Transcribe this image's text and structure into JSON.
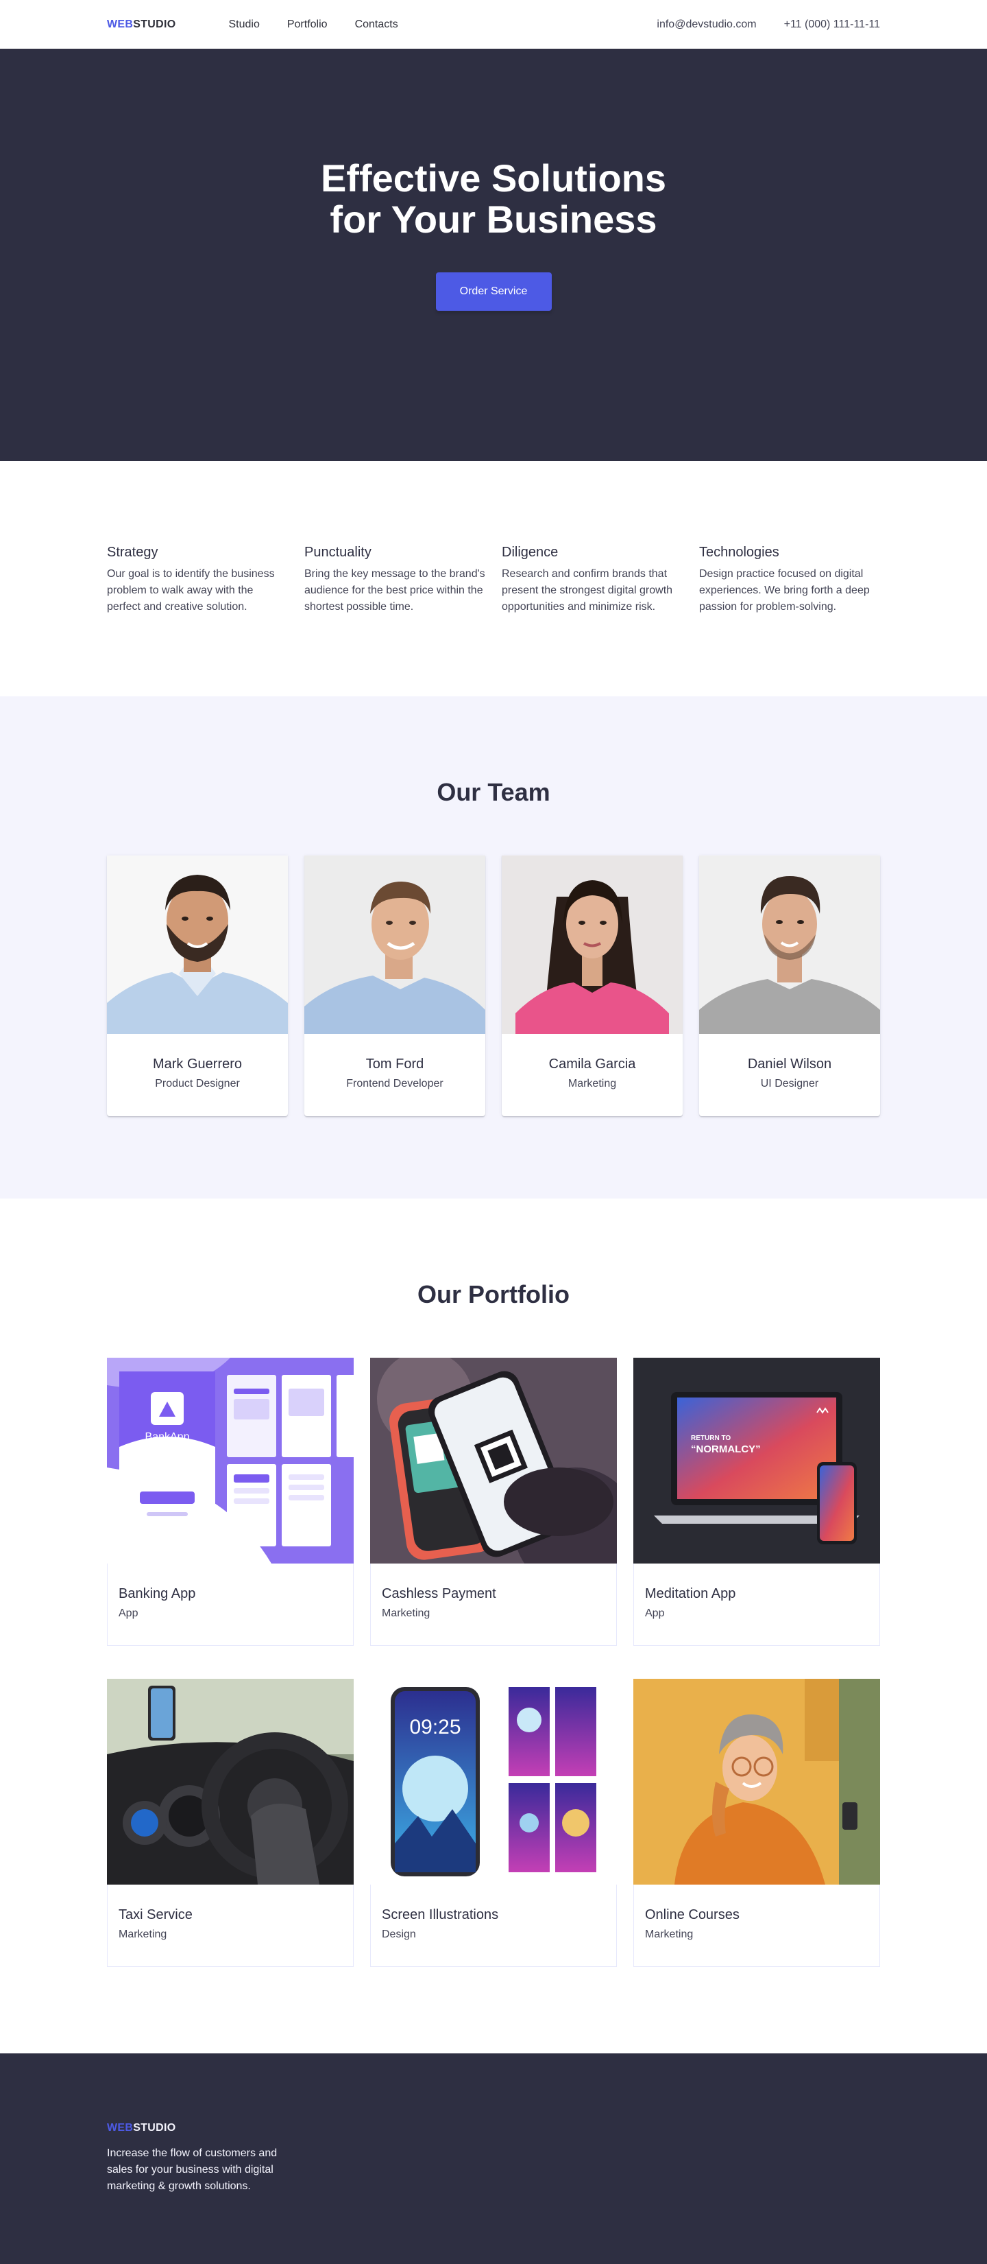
{
  "header": {
    "logo": {
      "accent": "Web",
      "rest": "Studio"
    },
    "nav": [
      "Studio",
      "Portfolio",
      "Contacts"
    ],
    "email": "info@devstudio.com",
    "phone": "+11 (000) 111-11-11"
  },
  "hero": {
    "title_line1": "Effective Solutions",
    "title_line2": "for Your Business",
    "button": "Order Service"
  },
  "features": [
    {
      "title": "Strategy",
      "text": "Our goal is to identify the business problem to walk away with the perfect and creative solution."
    },
    {
      "title": "Punctuality",
      "text": "Bring the key message to the brand's audience for the best price within the shortest possible time."
    },
    {
      "title": "Diligence",
      "text": "Research and confirm brands that present the strongest digital growth opportunities and minimize risk."
    },
    {
      "title": "Technologies",
      "text": "Design practice focused on digital experiences. We bring forth a deep passion for problem-solving."
    }
  ],
  "team": {
    "title": "Our Team",
    "members": [
      {
        "name": "Mark Guerrero",
        "role": "Product Designer"
      },
      {
        "name": "Tom Ford",
        "role": "Frontend Developer"
      },
      {
        "name": "Camila Garcia",
        "role": "Marketing"
      },
      {
        "name": "Daniel Wilson",
        "role": "UI Designer"
      }
    ]
  },
  "portfolio": {
    "title": "Our Portfolio",
    "items": [
      {
        "title": "Banking App",
        "category": "App",
        "image_text": "BankApp"
      },
      {
        "title": "Cashless Payment",
        "category": "Marketing"
      },
      {
        "title": "Meditation App",
        "category": "App",
        "image_text_1": "RETURN TO",
        "image_text_2": "“NORMALCY”"
      },
      {
        "title": "Taxi Service",
        "category": "Marketing"
      },
      {
        "title": "Screen Illustrations",
        "category": "Design",
        "image_text": "09:25"
      },
      {
        "title": "Online Courses",
        "category": "Marketing"
      }
    ]
  },
  "footer": {
    "logo": {
      "accent": "Web",
      "rest": "Studio"
    },
    "text": "Increase the flow of customers and sales for your business with digital marketing & growth solutions."
  },
  "colors": {
    "accent": "#4d5ae5",
    "dark": "#2e2f42",
    "team_bg": "#f4f4fd"
  }
}
